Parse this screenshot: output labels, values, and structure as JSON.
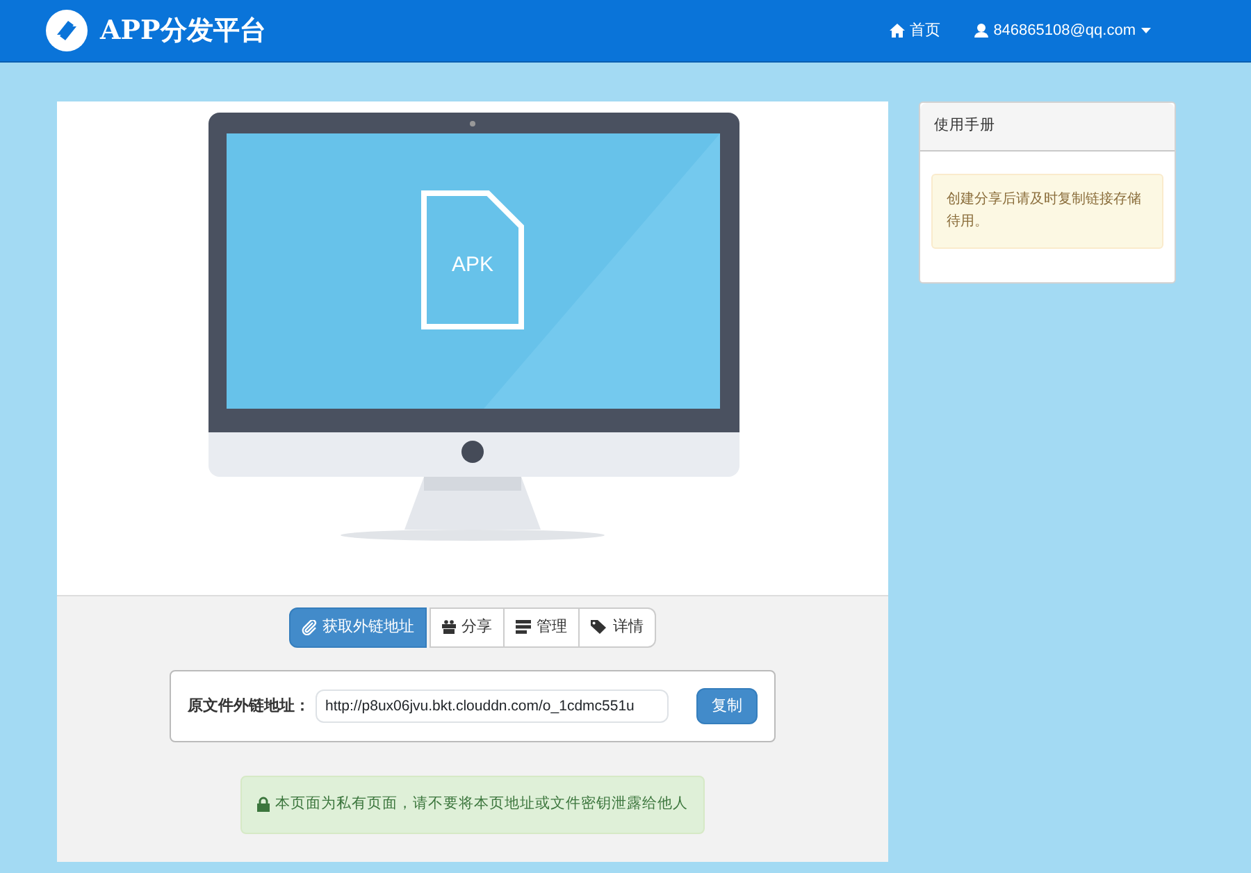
{
  "navbar": {
    "brand": "APP分发平台",
    "links": [
      {
        "kind": "home",
        "label": "首页"
      },
      {
        "kind": "user",
        "label": "846865108@qq.com",
        "dropdown": true
      }
    ]
  },
  "preview": {
    "file_label": "APK"
  },
  "tabs": [
    {
      "kind": "link",
      "label": "获取外链地址",
      "selected": true
    },
    {
      "kind": "share",
      "label": "分享",
      "selected": false
    },
    {
      "kind": "manage",
      "label": "管理",
      "selected": false
    },
    {
      "kind": "details",
      "label": "详情",
      "selected": false
    }
  ],
  "link_panel": {
    "label": "原文件外链地址：",
    "value": "http://p8ux06jvu.bkt.clouddn.com/o_1cdmc551u",
    "button": "复制"
  },
  "notice": "本页面为私有页面，请不要将本页地址或文件密钥泄露给他人",
  "sidebar": {
    "title": "使用手册",
    "tip": "创建分享后请及时复制链接存储待用。"
  }
}
